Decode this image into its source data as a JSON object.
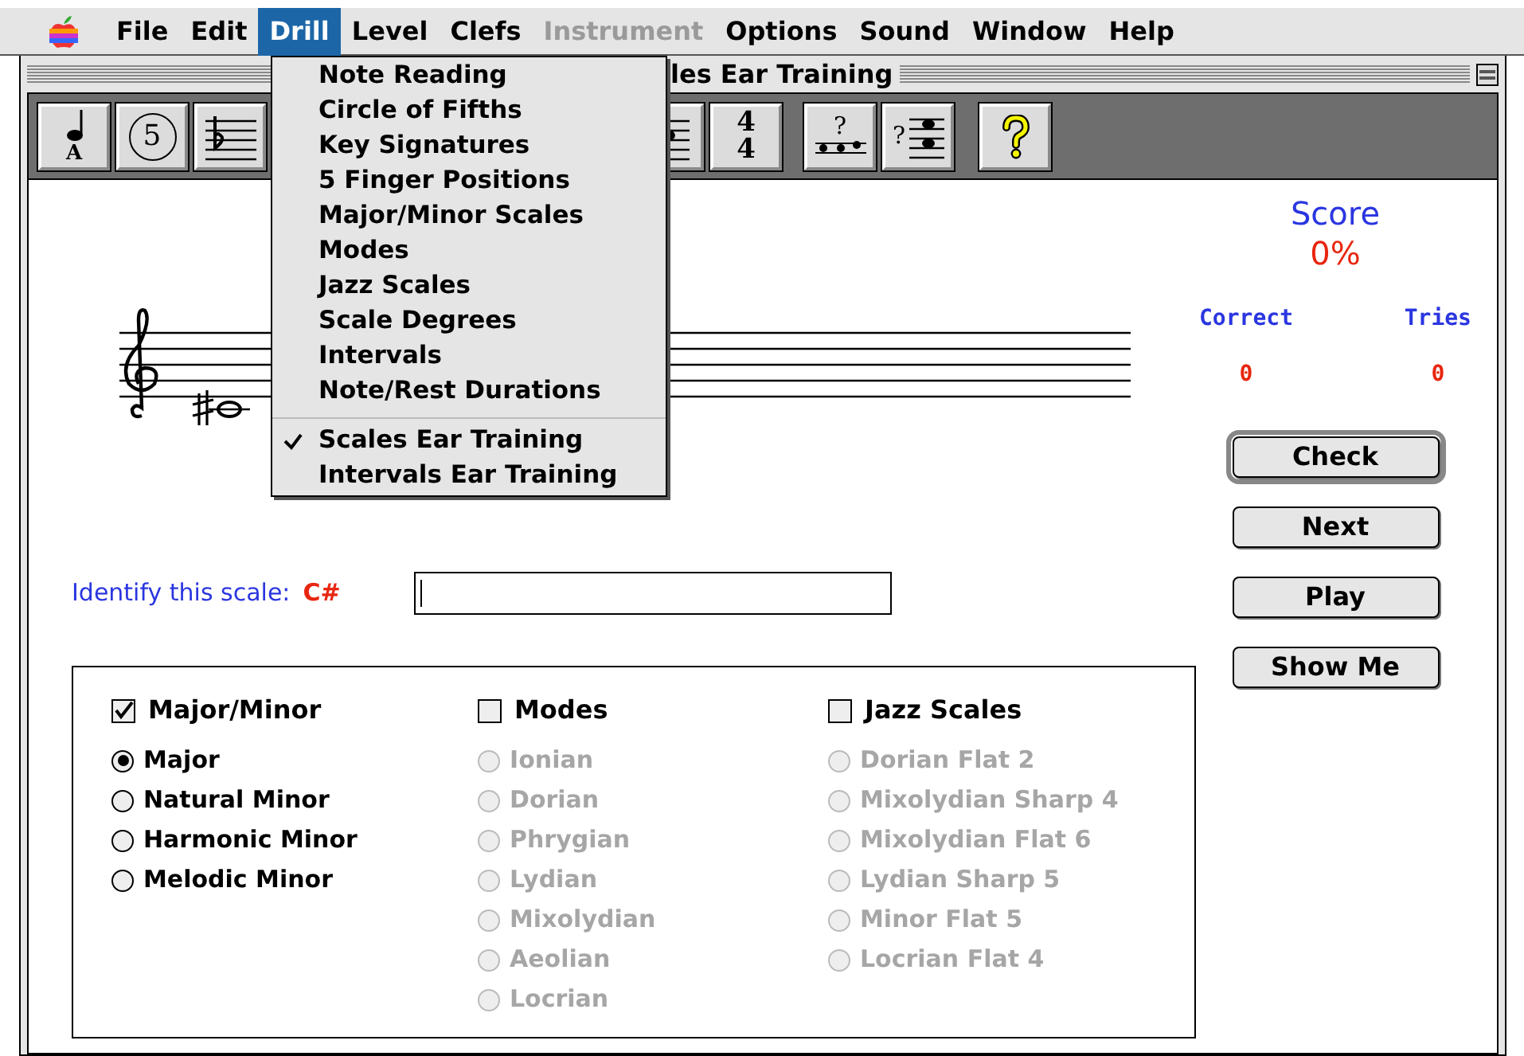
{
  "menu_bar": {
    "items": [
      {
        "label": "File",
        "selected": false,
        "disabled": false
      },
      {
        "label": "Edit",
        "selected": false,
        "disabled": false
      },
      {
        "label": "Drill",
        "selected": true,
        "disabled": false
      },
      {
        "label": "Level",
        "selected": false,
        "disabled": false
      },
      {
        "label": "Clefs",
        "selected": false,
        "disabled": false
      },
      {
        "label": "Instrument",
        "selected": false,
        "disabled": true
      },
      {
        "label": "Options",
        "selected": false,
        "disabled": false
      },
      {
        "label": "Sound",
        "selected": false,
        "disabled": false
      },
      {
        "label": "Window",
        "selected": false,
        "disabled": false
      },
      {
        "label": "Help",
        "selected": false,
        "disabled": false
      }
    ]
  },
  "drill_menu": {
    "groups": [
      [
        {
          "label": "Note Reading",
          "checked": false
        },
        {
          "label": "Circle of Fifths",
          "checked": false
        },
        {
          "label": "Key Signatures",
          "checked": false
        },
        {
          "label": "5 Finger Positions",
          "checked": false
        },
        {
          "label": "Major/Minor Scales",
          "checked": false
        },
        {
          "label": "Modes",
          "checked": false
        },
        {
          "label": "Jazz Scales",
          "checked": false
        },
        {
          "label": "Scale Degrees",
          "checked": false
        },
        {
          "label": "Intervals",
          "checked": false
        },
        {
          "label": "Note/Rest Durations",
          "checked": false
        }
      ],
      [
        {
          "label": "Scales Ear Training",
          "checked": true
        },
        {
          "label": "Intervals Ear Training",
          "checked": false
        }
      ]
    ]
  },
  "window": {
    "title": "les Ear Training"
  },
  "toolbar": {
    "left": [
      {
        "kind": "note-name",
        "label": "A"
      },
      {
        "kind": "circle",
        "label": "5"
      },
      {
        "kind": "flat-staff"
      }
    ],
    "right": [
      {
        "kind": "staff-note"
      },
      {
        "kind": "time",
        "label": "4",
        "label_2": "4"
      },
      {
        "kind": "question-notes",
        "label": "?"
      },
      {
        "kind": "question-staff",
        "label": "?"
      },
      {
        "kind": "help"
      }
    ]
  },
  "exercise": {
    "prompt": "Identify this scale:",
    "scale": "C#"
  },
  "score": {
    "title": "Score",
    "percent": "0%",
    "columns": [
      {
        "label": "Correct",
        "value": "0"
      },
      {
        "label": "Tries",
        "value": "0"
      }
    ]
  },
  "buttons": [
    {
      "label": "Check",
      "default": true
    },
    {
      "label": "Next",
      "default": false
    },
    {
      "label": "Play",
      "default": false
    },
    {
      "label": "Show Me",
      "default": false
    }
  ],
  "scale_groups": [
    {
      "label": "Major/Minor",
      "checked": true,
      "options": [
        {
          "label": "Major",
          "selected": true
        },
        {
          "label": "Natural Minor",
          "selected": false
        },
        {
          "label": "Harmonic Minor",
          "selected": false
        },
        {
          "label": "Melodic Minor",
          "selected": false
        }
      ]
    },
    {
      "label": "Modes",
      "checked": false,
      "options": [
        {
          "label": "Ionian",
          "selected": false
        },
        {
          "label": "Dorian",
          "selected": false
        },
        {
          "label": "Phrygian",
          "selected": false
        },
        {
          "label": "Lydian",
          "selected": false
        },
        {
          "label": "Mixolydian",
          "selected": false
        },
        {
          "label": "Aeolian",
          "selected": false
        },
        {
          "label": "Locrian",
          "selected": false
        }
      ]
    },
    {
      "label": "Jazz Scales",
      "checked": false,
      "options": [
        {
          "label": "Dorian Flat 2",
          "selected": false
        },
        {
          "label": "Mixolydian Sharp 4",
          "selected": false
        },
        {
          "label": "Mixolydian Flat 6",
          "selected": false
        },
        {
          "label": "Lydian Sharp 5",
          "selected": false
        },
        {
          "label": "Minor Flat 5",
          "selected": false
        },
        {
          "label": "Locrian Flat 4",
          "selected": false
        }
      ]
    }
  ]
}
